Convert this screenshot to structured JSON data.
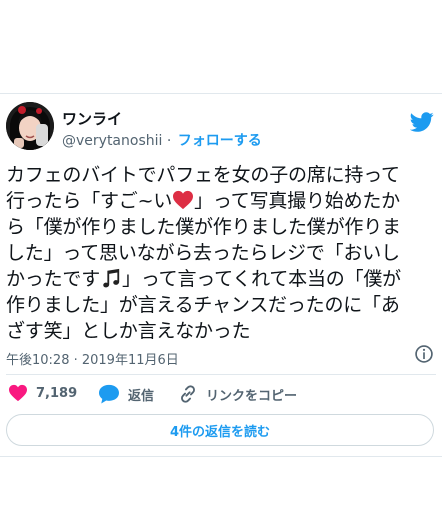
{
  "colors": {
    "accent": "#1d9bf0",
    "heart": "#f91880",
    "text": "#0f1419",
    "muted": "#536471",
    "border": "#cfd9de"
  },
  "user": {
    "name": "ワンライ",
    "handle": "@verytanoshii",
    "separator": "·",
    "follow_label": "フォローする"
  },
  "tweet": {
    "lines": [
      {
        "text": "カフェのバイトでパフェを女の子の席に持って"
      },
      {
        "before": "行ったら「すご~い",
        "after": "」って写真撮り始めたか"
      },
      {
        "text": "ら「僕が作りました僕が作りました僕が作りま"
      },
      {
        "text": "した」って思いながら去ったらレジで「おいし"
      },
      {
        "before": "かったです",
        "after": "」って言ってくれて本当の「僕が"
      },
      {
        "text": "作りました」が言えるチャンスだったのに「あ"
      },
      {
        "text": "ざす笑」としか言えなかった"
      }
    ],
    "timestamp": "午後10:28 · 2019年11月6日"
  },
  "icons": {
    "brand": "twitter-bird-icon",
    "emoji_heart": "red-heart-emoji",
    "emoji_music": "music-note-emoji",
    "info": "info-icon",
    "like": "heart-icon",
    "reply": "reply-bubble-icon",
    "copy_link": "link-icon"
  },
  "actions": {
    "like_count": "7,189",
    "reply_label": "返信",
    "copy_link_label": "リンクをコピー",
    "read_replies_label": "4件の返信を読む"
  }
}
